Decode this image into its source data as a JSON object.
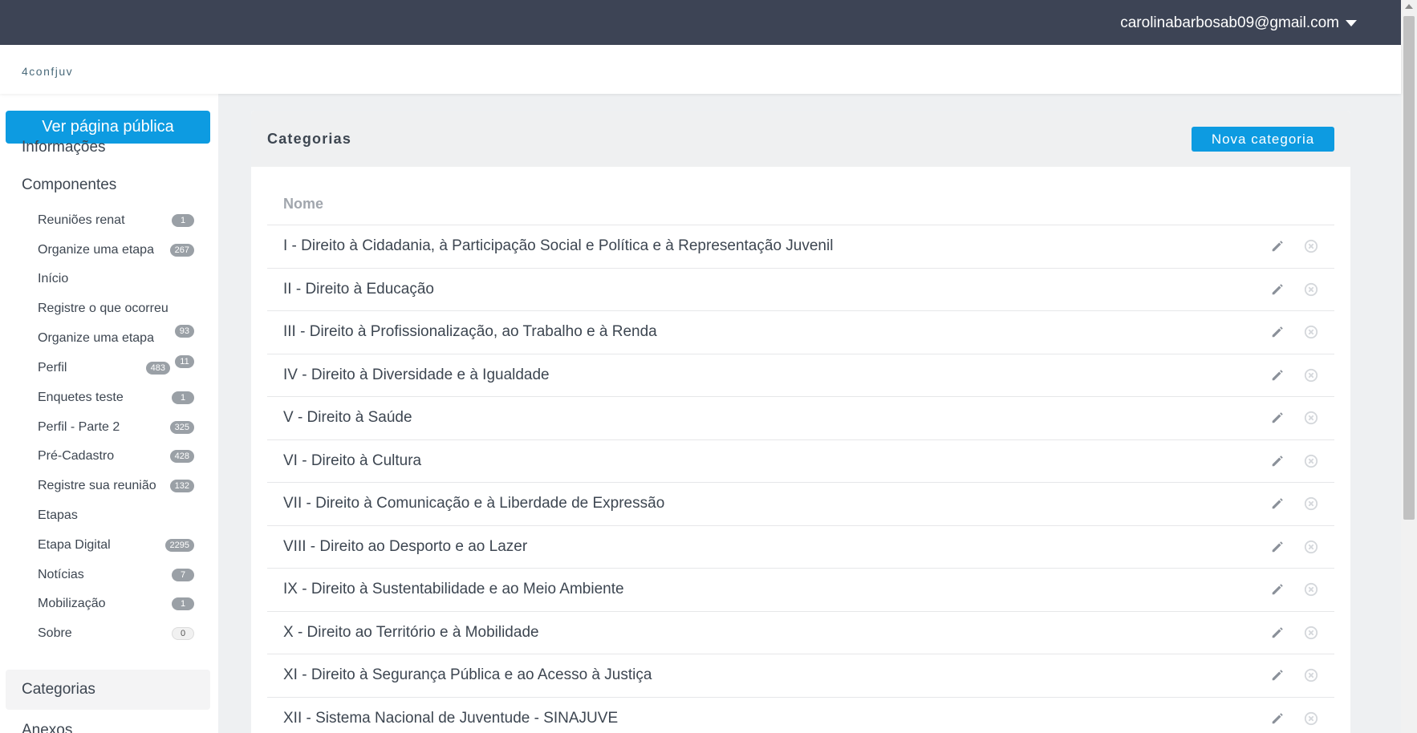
{
  "topbar": {
    "user_email": "carolinabarbosab09@gmail.com"
  },
  "brand": "4confjuv",
  "sidebar": {
    "public_button": "Ver página pública",
    "informacoes": "Informações",
    "componentes": "Componentes",
    "items": [
      {
        "label": "Reuniões renat",
        "badge": "1"
      },
      {
        "label": "Organize uma etapa",
        "badge": "267"
      },
      {
        "label": "Início",
        "badge": ""
      },
      {
        "label": "Registre o que ocorreu",
        "badge": ""
      },
      {
        "label": "Organize uma etapa",
        "badge": "93"
      },
      {
        "label": "Perfil",
        "badge": "483",
        "badge2": "11"
      },
      {
        "label": "Enquetes teste",
        "badge": "1"
      },
      {
        "label": "Perfil - Parte 2",
        "badge": "325"
      },
      {
        "label": "Pré-Cadastro",
        "badge": "428"
      },
      {
        "label": "Registre sua reunião",
        "badge": "132"
      },
      {
        "label": "Etapas",
        "badge": ""
      },
      {
        "label": "Etapa Digital",
        "badge": "2295"
      },
      {
        "label": "Notícias",
        "badge": "7"
      },
      {
        "label": "Mobilização",
        "badge": "1"
      },
      {
        "label": "Sobre",
        "badge": "0"
      }
    ],
    "active": "Categorias",
    "next": "Anexos"
  },
  "main": {
    "title": "Categorias",
    "new_button": "Nova categoria",
    "column_header": "Nome",
    "rows": [
      "I - Direito à Cidadania, à Participação Social e Política e à Representação Juvenil",
      "II - Direito à Educação",
      "III - Direito à Profissionalização, ao Trabalho e à Renda",
      "IV - Direito à Diversidade e à Igualdade",
      "V - Direito à Saúde",
      "VI - Direito à Cultura",
      "VII - Direito à Comunicação e à Liberdade de Expressão",
      "VIII - Direito ao Desporto e ao Lazer",
      "IX - Direito à Sustentabilidade e ao Meio Ambiente",
      "X - Direito ao Território e à Mobilidade",
      "XI - Direito à Segurança Pública e ao Acesso à Justiça",
      "XII - Sistema Nacional de Juventude - SINAJUVE"
    ]
  },
  "colors": {
    "topbar": "#3d4455",
    "accent": "#0d9be1"
  }
}
